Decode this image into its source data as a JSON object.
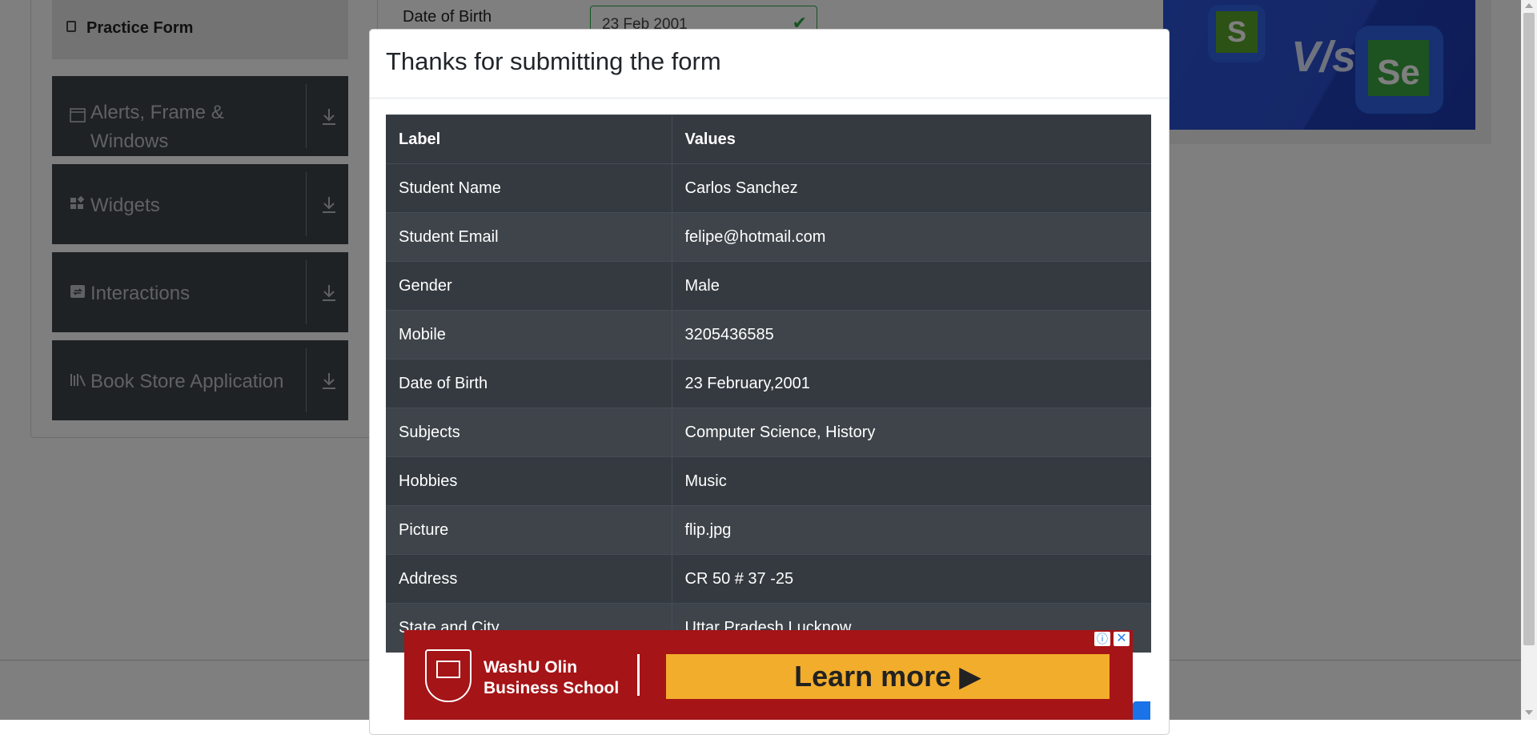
{
  "sidebar": {
    "practice_form": "Practice Form",
    "groups": [
      {
        "label": "Alerts, Frame & Windows",
        "icon": "window-icon"
      },
      {
        "label": "Widgets",
        "icon": "widgets-icon"
      },
      {
        "label": "Interactions",
        "icon": "interactions-icon"
      },
      {
        "label": "Book Store Application",
        "icon": "books-icon"
      }
    ]
  },
  "form": {
    "dob_label": "Date of Birth",
    "dob_value": "23 Feb 2001"
  },
  "right_ad": {
    "s_letter": "S",
    "vs": "V/s",
    "se_text": "Se"
  },
  "modal": {
    "title": "Thanks for submitting the form",
    "table": {
      "headers": [
        "Label",
        "Values"
      ],
      "rows": [
        [
          "Student Name",
          "Carlos Sanchez"
        ],
        [
          "Student Email",
          "felipe@hotmail.com"
        ],
        [
          "Gender",
          "Male"
        ],
        [
          "Mobile",
          "3205436585"
        ],
        [
          "Date of Birth",
          "23 February,2001"
        ],
        [
          "Subjects",
          "Computer Science, History"
        ],
        [
          "Hobbies",
          "Music"
        ],
        [
          "Picture",
          "flip.jpg"
        ],
        [
          "Address",
          "CR 50 # 37 -25"
        ],
        [
          "State and City",
          "Uttar Pradesh Lucknow"
        ]
      ]
    }
  },
  "bottom_ad": {
    "school_line1": "WashU Olin",
    "school_line2": "Business School",
    "cta": "Learn more ▶"
  },
  "colors": {
    "table_dark": "#343a40",
    "table_alt": "#3e444a",
    "ad_red": "#a51417",
    "ad_yellow": "#f2ad2c",
    "valid_green": "#28a745"
  }
}
